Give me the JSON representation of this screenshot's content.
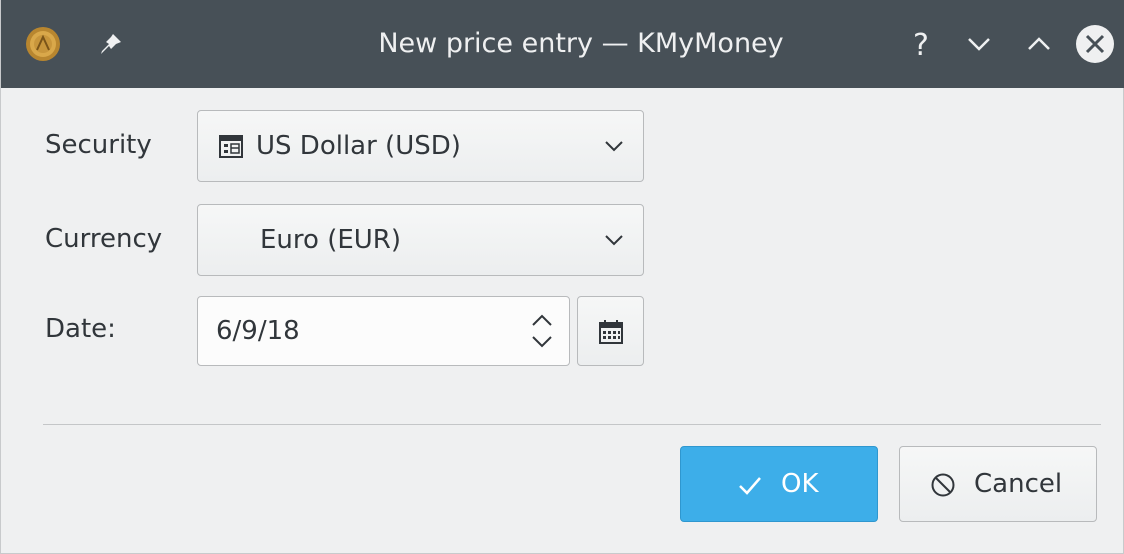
{
  "window": {
    "title": "New price entry — KMyMoney",
    "icons": {
      "app": "kmymoney-app-icon",
      "pin": "pin-icon",
      "help": "help-icon",
      "minimize": "minimize-icon",
      "maximize": "maximize-icon",
      "close": "close-icon"
    },
    "help_glyph": "?"
  },
  "form": {
    "security": {
      "label": "Security",
      "value": "US Dollar (USD)",
      "icon": "security-icon"
    },
    "currency": {
      "label": "Currency",
      "value": "Euro (EUR)"
    },
    "date": {
      "label": "Date:",
      "value": "6/9/18"
    }
  },
  "buttons": {
    "ok": {
      "label": "OK",
      "icon": "checkmark-icon"
    },
    "cancel": {
      "label": "Cancel",
      "icon": "cancel-icon"
    }
  },
  "colors": {
    "titlebar": "#475057",
    "accent": "#3daee9",
    "window_bg": "#eff0f1"
  }
}
